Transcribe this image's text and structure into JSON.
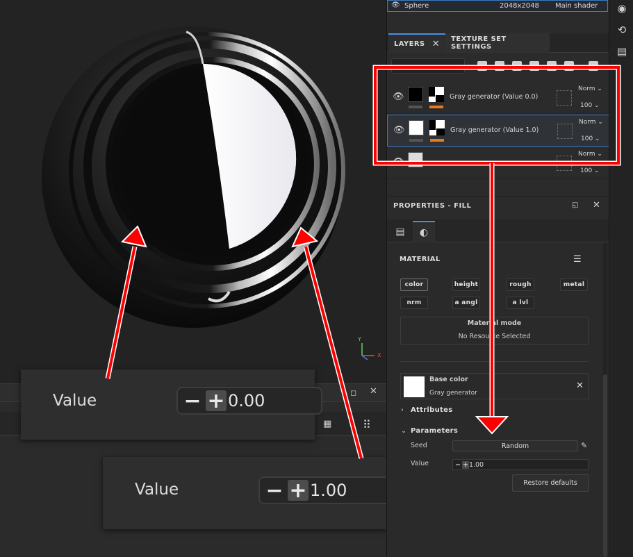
{
  "texture_set": {
    "name": "Sphere",
    "resolution": "2048x2048",
    "shader": "Main shader"
  },
  "tabs": {
    "layers": "LAYERS",
    "texture_set_settings": "TEXTURE SET SETTINGS"
  },
  "layers": [
    {
      "name": "Gray generator (Value 0.0)",
      "blend": "Norm",
      "opacity": "100",
      "selected": false
    },
    {
      "name": "Gray generator (Value 1.0)",
      "blend": "Norm",
      "opacity": "100",
      "selected": true
    },
    {
      "name": "",
      "blend": "Norm",
      "opacity": "100",
      "selected": false
    }
  ],
  "properties": {
    "title": "PROPERTIES - FILL",
    "material_label": "MATERIAL",
    "channels": [
      "color",
      "height",
      "rough",
      "metal",
      "nrm",
      "a angl",
      "a lvl"
    ],
    "material_mode_label": "Material mode",
    "material_mode_value": "No Resource Selected",
    "base_color_label": "Base color",
    "base_color_source": "Gray generator",
    "attributes_label": "Attributes",
    "parameters_label": "Parameters",
    "seed_label": "Seed",
    "seed_value": "Random",
    "value_label": "Value",
    "value_value": "1.00",
    "restore_label": "Restore defaults"
  },
  "callouts": [
    {
      "label": "Value",
      "value": "0.00"
    },
    {
      "label": "Value",
      "value": "1.00"
    }
  ],
  "axis_gizmo": {
    "y": "Y",
    "x": "X"
  },
  "colors": {
    "accent": "#3c7bc8",
    "annotation_red": "#ff0000",
    "mask_underline": "#e87a1c"
  }
}
